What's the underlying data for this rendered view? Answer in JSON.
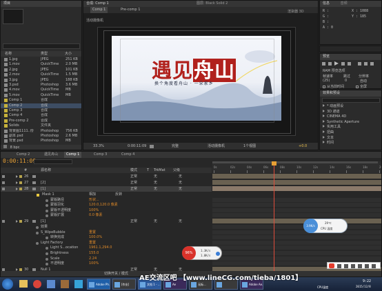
{
  "project": {
    "tab": "项目",
    "headers": [
      "名称",
      "类型",
      "大小"
    ],
    "items": [
      {
        "name": "1.jpg",
        "type": "JPEG",
        "size": "251 KB",
        "color": "#8c8c8c"
      },
      {
        "name": "1.mov",
        "type": "QuickTime",
        "size": "2.0 MB",
        "color": "#8c8c8c"
      },
      {
        "name": "2.jpg",
        "type": "JPEG",
        "size": "101 KB",
        "color": "#8c8c8c"
      },
      {
        "name": "2.mov",
        "type": "QuickTime",
        "size": "1.5 MB",
        "color": "#8c8c8c"
      },
      {
        "name": "3.jpg",
        "type": "JPEG",
        "size": "188 KB",
        "color": "#8c8c8c"
      },
      {
        "name": "3.psd",
        "type": "Photoshop",
        "size": "3.6 MB",
        "color": "#8c8c8c"
      },
      {
        "name": "4.mov",
        "type": "QuickTime",
        "size": "MB",
        "color": "#8c8c8c"
      },
      {
        "name": "5.mov",
        "type": "QuickTime",
        "size": "MB",
        "color": "#8c8c8c"
      },
      {
        "name": "Comp 1",
        "type": "合成",
        "size": "",
        "color": "#c7b23a"
      },
      {
        "name": "Comp 2",
        "type": "合成",
        "size": "",
        "color": "#c7b23a"
      },
      {
        "name": "Comp 3",
        "type": "合成",
        "size": "",
        "color": "#c7b23a"
      },
      {
        "name": "Comp 4",
        "type": "合成",
        "size": "",
        "color": "#c7b23a"
      },
      {
        "name": "Pre-comp 2",
        "type": "合成",
        "size": "",
        "color": "#c7b23a"
      },
      {
        "name": "Solids",
        "type": "文件夹",
        "size": "",
        "color": "#c7b23a"
      },
      {
        "name": "背景图1111..份",
        "type": "Photoshop",
        "size": "756 KB",
        "color": "#8c8c8c"
      },
      {
        "name": "副本.psd",
        "type": "Photoshop",
        "size": "2.6 MB",
        "color": "#8c8c8c"
      },
      {
        "name": "背景.psd",
        "type": "Photoshop",
        "size": "MB",
        "color": "#8c8c8c"
      }
    ],
    "footer": "8 bpc"
  },
  "composition": {
    "header": "合成: Comp 1",
    "tabs": [
      "Comp 1",
      "Pre-comp 1"
    ],
    "extra_tab": "图层: Black Solid 2",
    "view_label": "活动摄像机",
    "renderer_label": "渲染器 3D",
    "zoom": "33.3%",
    "timecode": "0:00:11:09",
    "quality": "完整",
    "camera_view": "活动摄像机",
    "view_count": "1个视图",
    "exposure": "+0.0",
    "title_part1": "遇见",
    "title_part2": "舟山",
    "subtitle": "换个角度看舟山 · 一朵家乡"
  },
  "info": {
    "tab": "信息",
    "r": "R :",
    "g": "G :",
    "b": "B :",
    "a": "A : 0",
    "x": "X : 1088",
    "y": "Y : 185"
  },
  "audio_tab": "音频",
  "preview": {
    "tab": "预览",
    "options_label": "RAM 预览选项",
    "frame_rate_label": "帧速率",
    "skip_label": "跳过",
    "resolution_label": "分辨率",
    "frame_rate": "(25)",
    "skip": "0",
    "resolution": "自动",
    "from_current": "从当前时间",
    "full_screen": "全屏"
  },
  "effects": {
    "tab": "效果和预设",
    "items": [
      "* 动画预设",
      "3D 通道",
      "CINEMA 4D",
      "Synthetic Aperture",
      "实用工具",
      "扭曲",
      "文本",
      "时间"
    ]
  },
  "timeline": {
    "tabs": [
      "Comp 2",
      "遇见舟山",
      "Comp 1",
      "Comp 3",
      "Comp 4"
    ],
    "timecode": "0:00:11:09",
    "columns": [
      "#",
      "源名称",
      "模式",
      "T",
      "TrkMat",
      "父级"
    ],
    "ruler": [
      "0s",
      "02s",
      "04s",
      "06s",
      "08s",
      "10s",
      "12s",
      "14s",
      "16s",
      "18s",
      "20s"
    ],
    "layers": [
      {
        "num": "26",
        "name": "",
        "mode": "正常",
        "trk": "无",
        "parent": "无",
        "color": "#b6a34d"
      },
      {
        "num": "27",
        "name": "[2]",
        "mode": "正常",
        "trk": "无",
        "parent": "无",
        "color": "#b6a34d"
      },
      {
        "num": "28",
        "name": "[1]",
        "mode": "正常",
        "trk": "无",
        "parent": "无",
        "color": "#b6a34d"
      }
    ],
    "mask": {
      "name": "Mask 1",
      "mode": "相加",
      "invert": "反转"
    },
    "mask_props": [
      {
        "label": "蒙版路径",
        "value": "形状..."
      },
      {
        "label": "蒙版羽化",
        "value": "120.0,120.0 像素"
      },
      {
        "label": "蒙版不透明度",
        "value": "100%"
      },
      {
        "label": "蒙版扩展",
        "value": "0.0 像素"
      }
    ],
    "layer29": {
      "num": "29",
      "name": "[1]",
      "mode": "正常",
      "trk": "无",
      "parent": "无"
    },
    "effects_rows": [
      {
        "label": "效果",
        "value": ""
      },
      {
        "label": "S_WipeBubble",
        "value": "重置"
      },
      {
        "label": "转换完成",
        "value": "100.0%"
      },
      {
        "label": "Light Factory",
        "value": "重置"
      },
      {
        "label": "Light S...ocation",
        "value": "1961.1,294.0"
      },
      {
        "label": "Brightness",
        "value": "155.0"
      },
      {
        "label": "Scale",
        "value": "2.24"
      }
    ],
    "opacity_row": {
      "label": "不透明度",
      "value": "100%"
    },
    "layer30": {
      "num": "30",
      "name": "Null 1",
      "mode": "正常",
      "trk": "无",
      "parent": "无"
    },
    "layer31": {
      "num": "31",
      "name": "Camera 1"
    },
    "footer": "切换开关 / 模式"
  },
  "widget_cpu": {
    "percent": "96%",
    "up": "1.3K/s",
    "down": "1.0K/s"
  },
  "widget_temp": {
    "value": "3.9K/s",
    "cpu_label": "CPU 温度",
    "temp": "29℃"
  },
  "taskbar": {
    "apps": [
      "Adobe Ph...",
      "[作业]",
      "文档 1 - ...",
      "Ae",
      "无标...",
      "",
      "Adobe Ae..."
    ],
    "watermark": "AE交流区吧  【www.lineCG.com/tieba/1801】",
    "clock_time": "9:22",
    "clock_date": "2015/12/8",
    "cpu_temp": "CPU温度"
  }
}
